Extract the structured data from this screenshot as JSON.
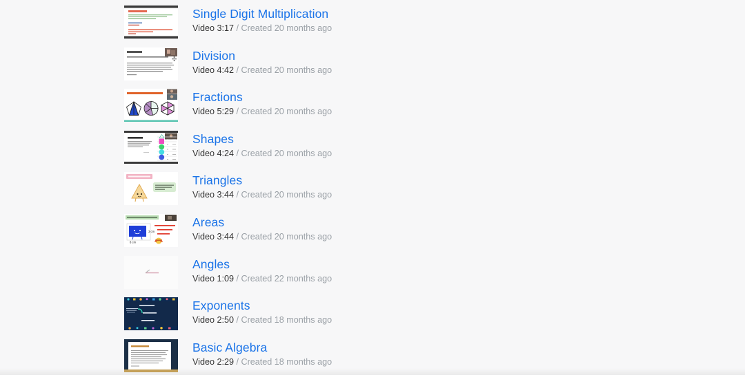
{
  "background_color": "#f7f7f8",
  "link_color": "#1a73e8",
  "meta_duration_color": "#333333",
  "meta_created_color": "#9aa0a6",
  "videos": [
    {
      "title": "Single Digit Multiplication",
      "duration_label": "Video 3:17",
      "created_label": "/ Created 20 months ago",
      "thumbnail": "document-red-text-slide"
    },
    {
      "title": "Division",
      "duration_label": "Video 4:42",
      "created_label": "/ Created 20 months ago",
      "thumbnail": "division-sign-text-slide"
    },
    {
      "title": "Fractions",
      "duration_label": "Video 5:29",
      "created_label": "/ Created 20 months ago",
      "thumbnail": "fractions-shapes-slide"
    },
    {
      "title": "Shapes",
      "duration_label": "Video 4:24",
      "created_label": "/ Created 20 months ago",
      "thumbnail": "number-of-sides-table-slide"
    },
    {
      "title": "Triangles",
      "duration_label": "Video 3:44",
      "created_label": "/ Created 20 months ago",
      "thumbnail": "triangle-character-slide"
    },
    {
      "title": "Areas",
      "duration_label": "Video 3:44",
      "created_label": "/ Created 20 months ago",
      "thumbnail": "area-rectangle-formula-slide"
    },
    {
      "title": "Angles",
      "duration_label": "Video 1:09",
      "created_label": "/ Created 22 months ago",
      "thumbnail": "blank-angle-sketch-slide"
    },
    {
      "title": "Exponents",
      "duration_label": "Video 2:50",
      "created_label": "/ Created 18 months ago",
      "thumbnail": "dark-navy-exponent-equations-slide"
    },
    {
      "title": "Basic Algebra",
      "duration_label": "Video 2:29",
      "created_label": "/ Created 18 months ago",
      "thumbnail": "framed-document-simple-equations-slide"
    }
  ]
}
